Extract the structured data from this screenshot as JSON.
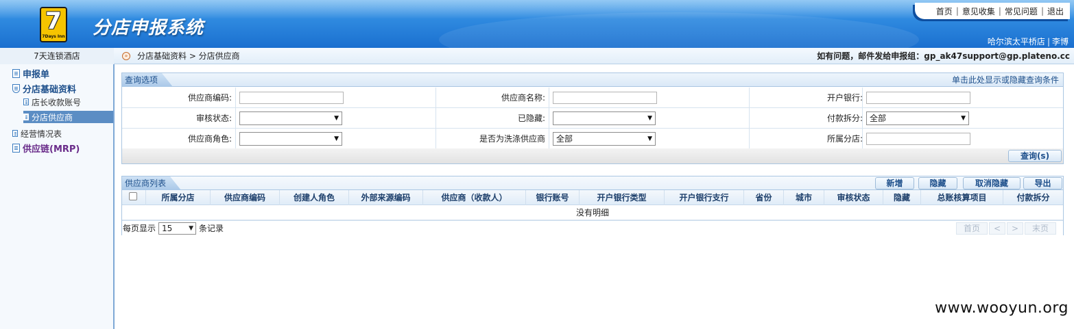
{
  "header": {
    "logo_number": "7",
    "logo_text": "7Days Inn",
    "system_title": "分店申报系统",
    "nav": [
      "首页",
      "意见收集",
      "常见问题",
      "退出"
    ],
    "store": "哈尔滨太平桥店",
    "user": "李博"
  },
  "subbar": {
    "hotel": "7天连锁酒店",
    "breadcrumb": "分店基础资料 > 分店供应商",
    "contact": "如有问题，邮件发给申报组：gp_ak47support@gp.plateno.cc"
  },
  "sidebar": {
    "items": [
      "申报单",
      "分店基础资料",
      "店长收款账号",
      "分店供应商",
      "经营情况表",
      "供应链(MRP)"
    ]
  },
  "query": {
    "title": "查询选项",
    "toggle": "单击此处显示或隐藏查询条件",
    "labels": {
      "supplier_code": "供应商编码:",
      "supplier_name": "供应商名称:",
      "bank": "开户银行:",
      "audit_status": "审核状态:",
      "hidden": "已隐藏:",
      "payment_split": "付款拆分:",
      "supplier_role": "供应商角色:",
      "is_laundry": "是否为洗涤供应商",
      "branch": "所属分店:"
    },
    "values": {
      "supplier_code": "",
      "supplier_name": "",
      "bank": "",
      "audit_status": "",
      "hidden": "",
      "payment_split": "全部",
      "supplier_role": "",
      "is_laundry": "全部",
      "branch": ""
    },
    "search_button": "查询(s)"
  },
  "list": {
    "title": "供应商列表",
    "buttons": [
      "新增",
      "隐藏",
      "取消隐藏",
      "导出"
    ],
    "columns": [
      "所属分店",
      "供应商编码",
      "创建人角色",
      "外部来源编码",
      "供应商（收款人）",
      "银行账号",
      "开户银行类型",
      "开户银行支行",
      "省份",
      "城市",
      "审核状态",
      "隐藏",
      "总账核算项目",
      "付款拆分"
    ],
    "empty": "没有明细",
    "pager": {
      "per_page_label": "每页显示",
      "page_size": "15",
      "records_label": "条记录",
      "first": "首页",
      "prev": "<",
      "next": ">",
      "last": "末页"
    }
  },
  "watermark": "www.wooyun.org",
  "colors": {
    "header_blue": "#1a6fcf",
    "panel_border": "#aac6e2",
    "sidebar_active": "#5b8dc4",
    "link_blue": "#1d4f8b"
  }
}
